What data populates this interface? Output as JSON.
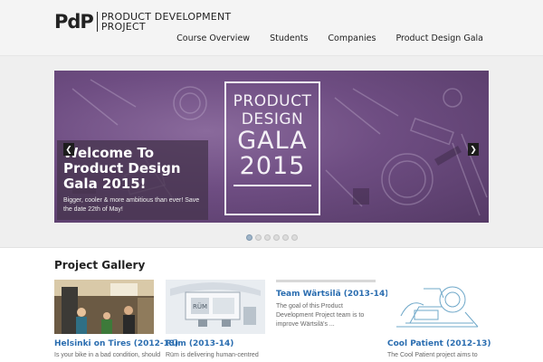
{
  "header": {
    "logo_mark": "PdP",
    "logo_line1": "PRODUCT DEVELOPMENT",
    "logo_line2": "PROJECT",
    "nav": [
      "Course Overview",
      "Students",
      "Companies",
      "Product Design Gala"
    ]
  },
  "slider": {
    "poster_lines": [
      "PRODUCT",
      "DESIGN",
      "GALA",
      "2015"
    ],
    "caption_title": "Welcome To Product Design Gala 2015!",
    "caption_text": "Bigger, cooler & more ambitious than ever! Save the date 22th of May!",
    "prev_symbol": "❮",
    "next_symbol": "❯",
    "slide_count": 6,
    "active_slide": 1
  },
  "gallery": {
    "title": "Project Gallery",
    "items": [
      {
        "title": "Helsinki on Tires (2012-13)",
        "desc": "Is your bike in a bad condition, should"
      },
      {
        "title": "Rüm (2013-14)",
        "desc": "Rüm is delivering human-centred"
      },
      {
        "title": "Team Wärtsilä (2013-14)",
        "desc": "The goal of this Product Development Project team is to improve Wärtsilä's ..."
      },
      {
        "title": "Cool Patient (2012-13)",
        "desc": "The Cool Patient project aims to"
      }
    ],
    "thumb_labels": {
      "rum": "RÜM"
    }
  },
  "colors": {
    "link": "#2a6db0",
    "hero_purple": "#6e4d82",
    "header_bg": "#f4f4f4"
  }
}
